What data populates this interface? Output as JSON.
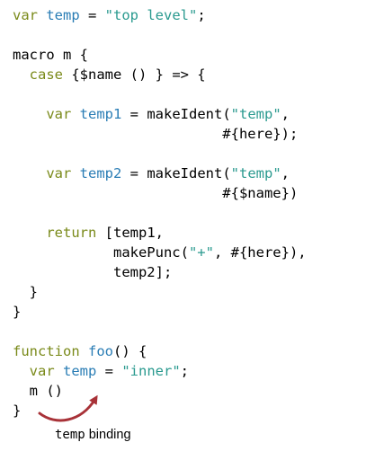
{
  "colors": {
    "keyword": "#7a8a1a",
    "identifier": "#2a7db5",
    "string": "#2a9a8f",
    "plain": "#000000",
    "arrow": "#a83238"
  },
  "code_lines": [
    [
      {
        "t": "kw",
        "s": "var"
      },
      {
        "t": "pl",
        "s": " "
      },
      {
        "t": "id",
        "s": "temp"
      },
      {
        "t": "pl",
        "s": " = "
      },
      {
        "t": "str",
        "s": "\"top level\""
      },
      {
        "t": "pl",
        "s": ";"
      }
    ],
    [],
    [
      {
        "t": "pl",
        "s": "macro m {"
      }
    ],
    [
      {
        "t": "pl",
        "s": "  "
      },
      {
        "t": "kw",
        "s": "case"
      },
      {
        "t": "pl",
        "s": " {$name () } => {"
      }
    ],
    [],
    [
      {
        "t": "pl",
        "s": "    "
      },
      {
        "t": "kw",
        "s": "var"
      },
      {
        "t": "pl",
        "s": " "
      },
      {
        "t": "id",
        "s": "temp1"
      },
      {
        "t": "pl",
        "s": " = makeIdent("
      },
      {
        "t": "str",
        "s": "\"temp\""
      },
      {
        "t": "pl",
        "s": ","
      }
    ],
    [
      {
        "t": "pl",
        "s": "                         #{here});"
      }
    ],
    [],
    [
      {
        "t": "pl",
        "s": "    "
      },
      {
        "t": "kw",
        "s": "var"
      },
      {
        "t": "pl",
        "s": " "
      },
      {
        "t": "id",
        "s": "temp2"
      },
      {
        "t": "pl",
        "s": " = makeIdent("
      },
      {
        "t": "str",
        "s": "\"temp\""
      },
      {
        "t": "pl",
        "s": ","
      }
    ],
    [
      {
        "t": "pl",
        "s": "                         #{$name})"
      }
    ],
    [],
    [
      {
        "t": "pl",
        "s": "    "
      },
      {
        "t": "kw",
        "s": "return"
      },
      {
        "t": "pl",
        "s": " [temp1,"
      }
    ],
    [
      {
        "t": "pl",
        "s": "            makePunc("
      },
      {
        "t": "str",
        "s": "\"+\""
      },
      {
        "t": "pl",
        "s": ", #{here}),"
      }
    ],
    [
      {
        "t": "pl",
        "s": "            temp2];"
      }
    ],
    [
      {
        "t": "pl",
        "s": "  }"
      }
    ],
    [
      {
        "t": "pl",
        "s": "}"
      }
    ],
    [],
    [
      {
        "t": "kw",
        "s": "function"
      },
      {
        "t": "pl",
        "s": " "
      },
      {
        "t": "id",
        "s": "foo"
      },
      {
        "t": "pl",
        "s": "() {"
      }
    ],
    [
      {
        "t": "pl",
        "s": "  "
      },
      {
        "t": "kw",
        "s": "var"
      },
      {
        "t": "pl",
        "s": " "
      },
      {
        "t": "id",
        "s": "temp"
      },
      {
        "t": "pl",
        "s": " = "
      },
      {
        "t": "str",
        "s": "\"inner\""
      },
      {
        "t": "pl",
        "s": ";"
      }
    ],
    [
      {
        "t": "pl",
        "s": "  m ()"
      }
    ],
    [
      {
        "t": "pl",
        "s": "}"
      }
    ]
  ],
  "annotation": {
    "caption_code": "temp",
    "caption_text": " binding"
  }
}
